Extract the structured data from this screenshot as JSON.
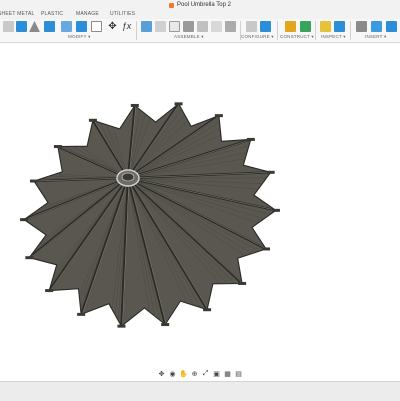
{
  "window": {
    "title": "Pool Umbrella Top 2"
  },
  "tabs": [
    {
      "label": "SHEET METAL"
    },
    {
      "label": "PLASTIC"
    },
    {
      "label": "MANAGE"
    },
    {
      "label": "UTILITIES"
    }
  ],
  "toolbar": {
    "groups": [
      {
        "label": "MODIFY ▾"
      },
      {
        "label": "ASSEMBLE ▾"
      },
      {
        "label": "CONFIGURE ▾"
      },
      {
        "label": "CONSTRUCT ▾"
      },
      {
        "label": "INSPECT ▾"
      },
      {
        "label": "INSERT ▾"
      }
    ],
    "function_icon": "ƒx"
  },
  "model": {
    "name": "pool umbrella canopy",
    "fill_color": "#59574f",
    "edge_color": "#2b2a25",
    "rib_count": 18
  },
  "nav_icons": [
    "move-icon",
    "look-icon",
    "pan-icon",
    "zoom-icon",
    "fit-icon",
    "display-mode-icon",
    "grid-icon",
    "viewport-icon"
  ],
  "accent_colors": {
    "orange": "#f07a2b",
    "blue": "#2c8ed6",
    "green": "#3aa35b"
  }
}
